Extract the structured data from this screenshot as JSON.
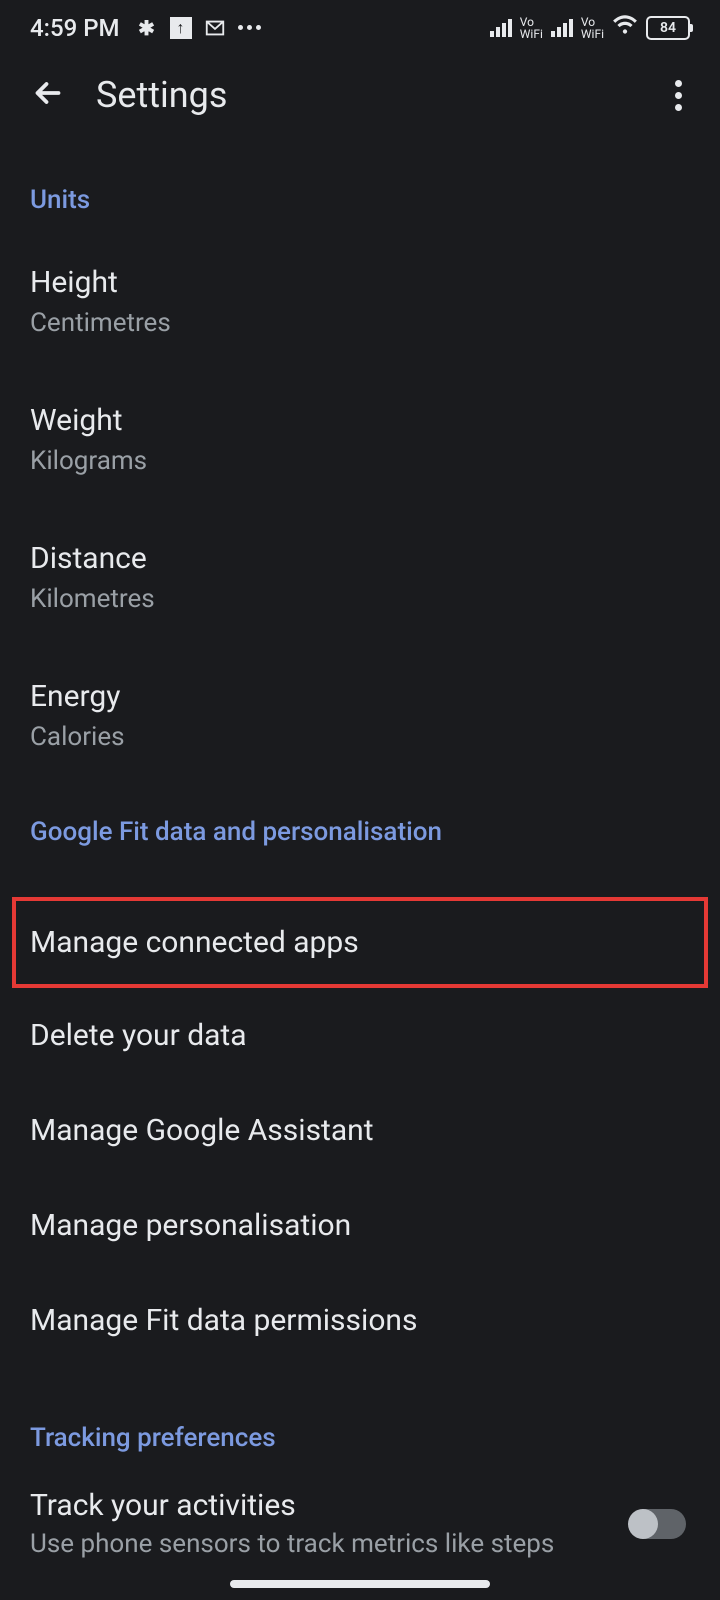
{
  "status": {
    "time": "4:59 PM",
    "battery": "84",
    "vowifi": "Vo\nWiFi"
  },
  "header": {
    "title": "Settings"
  },
  "sections": {
    "units": {
      "header": "Units",
      "items": [
        {
          "title": "Height",
          "value": "Centimetres"
        },
        {
          "title": "Weight",
          "value": "Kilograms"
        },
        {
          "title": "Distance",
          "value": "Kilometres"
        },
        {
          "title": "Energy",
          "value": "Calories"
        }
      ]
    },
    "fitdata": {
      "header": "Google Fit data and personalisation",
      "links": [
        "Manage connected apps",
        "Delete your data",
        "Manage Google Assistant",
        "Manage personalisation",
        "Manage Fit data permissions"
      ]
    },
    "tracking": {
      "header": "Tracking preferences",
      "item": {
        "title": "Track your activities",
        "subtitle": "Use phone sensors to track metrics like steps"
      }
    }
  }
}
